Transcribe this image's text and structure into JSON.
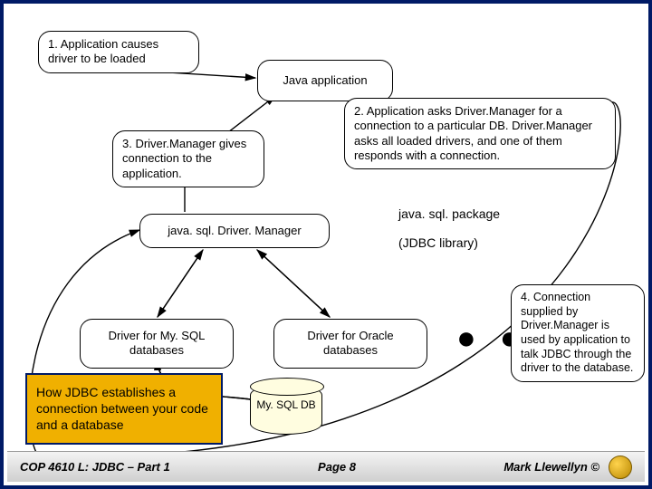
{
  "boxes": {
    "step1": "1.  Application causes driver to be loaded",
    "java_app": "Java application",
    "step3": "3.  Driver.Manager gives connection to the application.",
    "step2": "2.  Application asks Driver.Manager for a connection to a particular DB. Driver.Manager asks all loaded drivers, and one of them responds with a connection.",
    "driver_manager": "java. sql. Driver. Manager",
    "driver_mysql": "Driver for My. SQL databases",
    "driver_oracle": "Driver for Oracle databases",
    "step4": "4.  Connection supplied by Driver.Manager is used by application to talk JDBC through the driver to the database.",
    "ellipsis": "● ● ●"
  },
  "labels": {
    "package": "java. sql. package",
    "library": "(JDBC library)",
    "db": "My. SQL DB"
  },
  "title": "How JDBC establishes a connection between your code and a database",
  "footer": {
    "left": "COP 4610 L: JDBC – Part 1",
    "mid": "Page 8",
    "right": "Mark Llewellyn ©"
  },
  "colors": {
    "border": "#001a66",
    "accent": "#f0b000"
  }
}
